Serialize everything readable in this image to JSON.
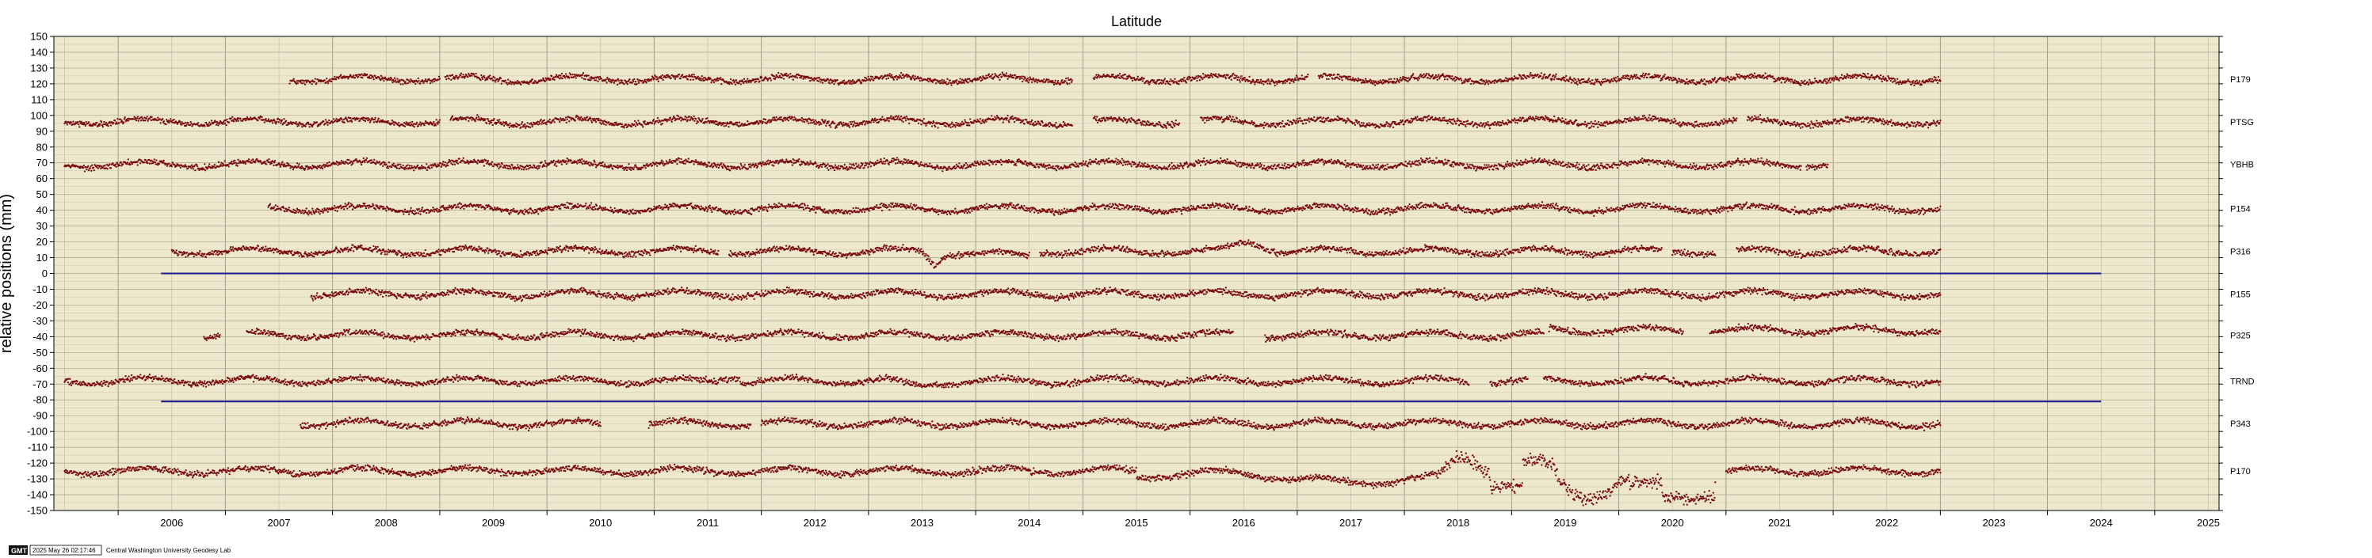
{
  "chart_data": {
    "type": "scatter",
    "title": "Latitude",
    "ylabel": "relative positions (mm)",
    "xlim": [
      2005.4,
      2025.6
    ],
    "ylim": [
      -150,
      150
    ],
    "x_ticks": [
      "2006",
      "2007",
      "2008",
      "2009",
      "2010",
      "2011",
      "2012",
      "2013",
      "2014",
      "2015",
      "2016",
      "2017",
      "2018",
      "2019",
      "2020",
      "2021",
      "2022",
      "2023",
      "2024",
      "2025"
    ],
    "y_ticks": [
      150,
      140,
      130,
      120,
      110,
      100,
      90,
      80,
      70,
      60,
      50,
      40,
      30,
      20,
      10,
      0,
      -10,
      -20,
      -30,
      -40,
      -50,
      -60,
      -70,
      -80,
      -90,
      -100,
      -110,
      -120,
      -130,
      -140,
      -150
    ],
    "grid": true,
    "background": "#ece7cd",
    "point_color": "#7a0a0a",
    "reference_line_color": "#1a1a8c",
    "reference_lines": [
      {
        "y": 0,
        "x_start": 2006.4,
        "x_end": 2024.5
      },
      {
        "y": -81,
        "x_start": 2006.4,
        "x_end": 2024.5
      }
    ],
    "series": [
      {
        "name": "P179",
        "offset": 123,
        "segments": [
          [
            2007.6,
            2009.0
          ],
          [
            2009.05,
            2014.9
          ],
          [
            2015.1,
            2017.1
          ],
          [
            2017.2,
            2023.0
          ]
        ]
      },
      {
        "name": "PTSG",
        "offset": 96,
        "segments": [
          [
            2005.5,
            2009.0
          ],
          [
            2009.1,
            2014.9
          ],
          [
            2015.1,
            2015.9
          ],
          [
            2016.1,
            2021.1
          ],
          [
            2021.2,
            2023.0
          ]
        ]
      },
      {
        "name": "YBHB",
        "offset": 69,
        "segments": [
          [
            2005.5,
            2021.7
          ],
          [
            2021.75,
            2021.95
          ]
        ]
      },
      {
        "name": "P154",
        "offset": 41,
        "segments": [
          [
            2007.4,
            2023.0
          ]
        ]
      },
      {
        "name": "P316",
        "offset": 14,
        "segments": [
          [
            2006.5,
            2011.6
          ],
          [
            2011.7,
            2014.5
          ],
          [
            2014.6,
            2020.4
          ],
          [
            2020.5,
            2020.9
          ],
          [
            2021.1,
            2023.0
          ]
        ]
      },
      {
        "name": "P155",
        "offset": -13,
        "segments": [
          [
            2007.8,
            2023.0
          ]
        ]
      },
      {
        "name": "P325",
        "offset": -39,
        "segments": [
          [
            2006.8,
            2006.95
          ],
          [
            2007.2,
            2016.4
          ],
          [
            2016.7,
            2019.3
          ],
          [
            2019.35,
            2020.6
          ],
          [
            2020.85,
            2023.0
          ]
        ]
      },
      {
        "name": "TRND",
        "offset": -68,
        "segments": [
          [
            2005.5,
            2018.6
          ],
          [
            2018.8,
            2019.15
          ],
          [
            2019.3,
            2023.0
          ]
        ]
      },
      {
        "name": "P343",
        "offset": -95,
        "segments": [
          [
            2007.7,
            2010.5
          ],
          [
            2010.95,
            2011.9
          ],
          [
            2012.0,
            2023.0
          ]
        ]
      },
      {
        "name": "P170",
        "offset": -125,
        "segments": [
          [
            2005.5,
            2020.9
          ],
          [
            2021.0,
            2023.0
          ]
        ]
      }
    ]
  },
  "footer": {
    "logo": "GMT",
    "timestamp": "2025 May 26 02:17:46",
    "credit": "Central Washington University Geodesy Lab"
  }
}
